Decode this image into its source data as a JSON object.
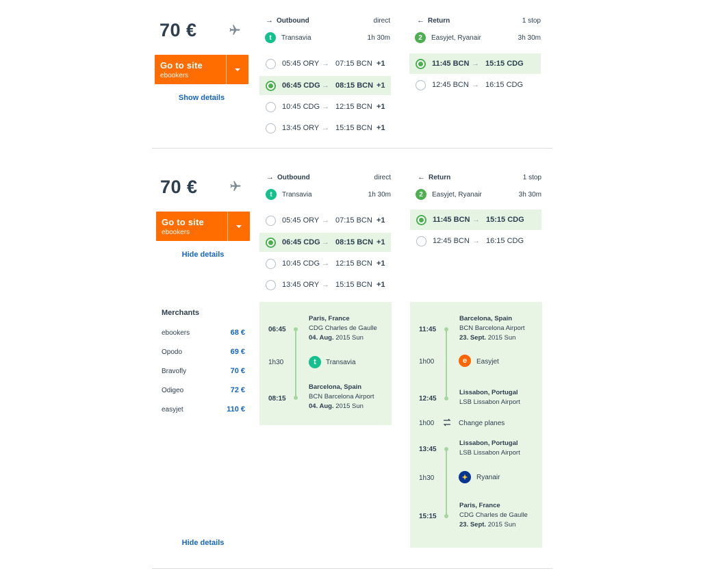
{
  "cards": [
    {
      "price": "70 €",
      "go_label": "Go to site",
      "go_sub": "ebookers",
      "details_link": "Show details",
      "outbound": {
        "title": "Outbound",
        "type": "direct",
        "carrier": "Transavia",
        "duration": "1h 30m",
        "options": [
          {
            "dep": "05:45 ORY",
            "arr": "07:15 BCN",
            "plus": "+1",
            "selected": false
          },
          {
            "dep": "06:45 CDG",
            "arr": "08:15 BCN",
            "plus": "+1",
            "selected": true
          },
          {
            "dep": "10:45 CDG",
            "arr": "12:15 BCN",
            "plus": "+1",
            "selected": false
          },
          {
            "dep": "13:45 ORY",
            "arr": "15:15 BCN",
            "plus": "+1",
            "selected": false
          }
        ]
      },
      "return": {
        "title": "Return",
        "type": "1 stop",
        "carrier_badge": "2",
        "carrier": "Easyjet, Ryanair",
        "duration": "3h 30m",
        "options": [
          {
            "dep": "11:45 BCN",
            "arr": "15:15 CDG",
            "selected": true
          },
          {
            "dep": "12:45 BCN",
            "arr": "16:15 CDG",
            "selected": false
          }
        ]
      }
    },
    {
      "price": "70 €",
      "go_label": "Go to site",
      "go_sub": "ebookers",
      "details_link": "Hide details",
      "outbound": {
        "title": "Outbound",
        "type": "direct",
        "carrier": "Transavia",
        "duration": "1h 30m",
        "options": [
          {
            "dep": "05:45 ORY",
            "arr": "07:15 BCN",
            "plus": "+1",
            "selected": false
          },
          {
            "dep": "06:45 CDG",
            "arr": "08:15 BCN",
            "plus": "+1",
            "selected": true
          },
          {
            "dep": "10:45 CDG",
            "arr": "12:15 BCN",
            "plus": "+1",
            "selected": false
          },
          {
            "dep": "13:45 ORY",
            "arr": "15:15 BCN",
            "plus": "+1",
            "selected": false
          }
        ]
      },
      "return": {
        "title": "Return",
        "type": "1 stop",
        "carrier_badge": "2",
        "carrier": "Easyjet, Ryanair",
        "duration": "3h 30m",
        "options": [
          {
            "dep": "11:45 BCN",
            "arr": "15:15 CDG",
            "selected": true
          },
          {
            "dep": "12:45 BCN",
            "arr": "16:15 CDG",
            "selected": false
          }
        ]
      },
      "merchants": {
        "title": "Merchants",
        "items": [
          {
            "name": "ebookers",
            "price": "68 €"
          },
          {
            "name": "Opodo",
            "price": "69 €"
          },
          {
            "name": "Bravofly",
            "price": "70 €"
          },
          {
            "name": "Odigeo",
            "price": "72 €"
          },
          {
            "name": "easyjet",
            "price": "110 €"
          }
        ]
      },
      "outbound_detail": {
        "dep_time": "06:45",
        "dep_city": "Paris, France",
        "dep_airport": "CDG Charles de Gaulle",
        "dep_date_bold": "04. Aug.",
        "dep_date_rest": "2015 Sun",
        "duration": "1h30",
        "carrier": "Transavia",
        "arr_time": "08:15",
        "arr_city": "Barcelona, Spain",
        "arr_airport": "BCN Barcelona Airport",
        "arr_date_bold": "04. Aug.",
        "arr_date_rest": "2015 Sun"
      },
      "return_detail": {
        "seg1_dep_time": "11:45",
        "seg1_dep_city": "Barcelona, Spain",
        "seg1_dep_airport": "BCN Barcelona Airport",
        "seg1_dep_date_bold": "23. Sept.",
        "seg1_dep_date_rest": "2015 Sun",
        "seg1_duration": "1h00",
        "seg1_carrier": "Easyjet",
        "seg1_arr_time": "12:45",
        "seg1_arr_city": "Lissabon, Portugal",
        "seg1_arr_airport": "LSB Lissabon Airport",
        "layover_duration": "1h00",
        "layover_label": "Change planes",
        "seg2_dep_time": "13:45",
        "seg2_dep_city": "Lissabon, Portugal",
        "seg2_dep_airport": "LSB Lissabon Airport",
        "seg2_duration": "1h30",
        "seg2_carrier": "Ryanair",
        "seg2_arr_time": "15:15",
        "seg2_arr_city": "Paris, France",
        "seg2_arr_airport": "CDG Charles de Gaulle",
        "seg2_arr_date_bold": "23. Sept.",
        "seg2_arr_date_rest": "2015 Sun"
      },
      "bottom_link": "Hide details"
    }
  ],
  "colors": {
    "accent": "#ff6d00",
    "link": "#1565c0",
    "selected_bg": "#e5f4e3",
    "detail_bg": "#e8f5e5",
    "transavia": "#14c08e",
    "easyjet": "#ff6600",
    "ryanair": "#073590"
  }
}
